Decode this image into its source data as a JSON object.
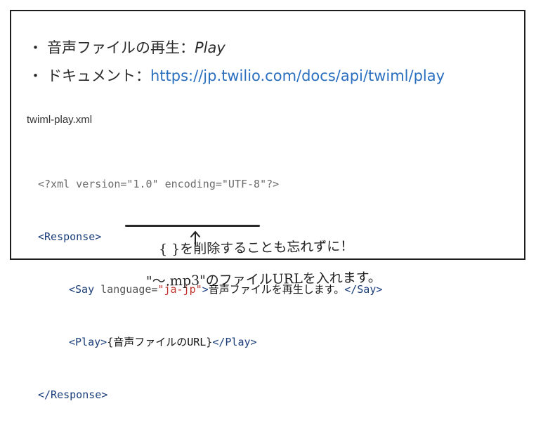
{
  "bullets": {
    "dot": "・",
    "play_label": "音声ファイルの再生：",
    "play_term": "Play",
    "doc_label": "ドキュメント：",
    "doc_url": "https://jp.twilio.com/docs/api/twiml/play"
  },
  "code_block": {
    "filename": "twiml-play.xml",
    "xml_decl": "<?xml version=\"1.0\" encoding=\"UTF-8\"?>",
    "response_open": "<Response>",
    "say_open": "<Say ",
    "say_attr": "language=",
    "say_value": "\"ja-jp\"",
    "say_tag_close": ">",
    "say_text": "音声ファイルを再生します。",
    "say_close": "</Say>",
    "play_open": "<Play>",
    "play_text": "{音声ファイルのURL}",
    "play_close": "</Play>",
    "response_close": "</Response>"
  },
  "annotations": {
    "note1": "{ }を削除することも忘れずに！",
    "note2": "\"～.mp3\"のファイルURLを入れます。"
  }
}
